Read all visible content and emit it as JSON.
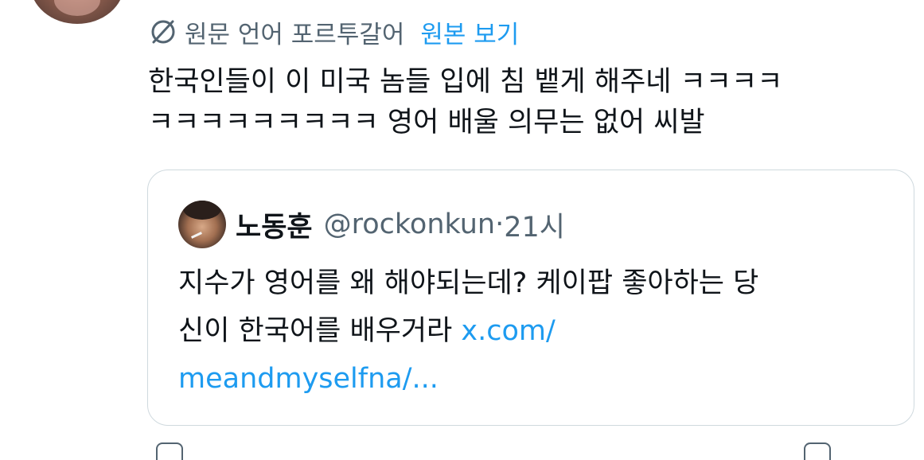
{
  "translation": {
    "original_language_label": "원문 언어 포르투갈어",
    "show_original_label": "원본 보기"
  },
  "tweet": {
    "text": "한국인들이 이 미국 놈들 입에 침 뱉게 해주네 ㅋㅋㅋㅋ\nㅋㅋㅋㅋㅋㅋㅋㅋㅋ 영어 배울 의무는 없어 씨발"
  },
  "quote": {
    "display_name": "노동훈",
    "handle": "@rockonkun",
    "separator": " · ",
    "time": "21시",
    "text": "지수가 영어를 왜 해야되는데? 케이팝 좋아하는 당\n신이 한국어를 배우거라 ",
    "link_text": "x.com/\nmeandmyselfna/..."
  },
  "icons": {
    "translate": "translate-globe-icon",
    "action_left": "reply-icon",
    "action_right": "share-icon"
  },
  "colors": {
    "accent": "#1d9bf0",
    "secondary_text": "#536471",
    "border": "#cfd9de"
  }
}
